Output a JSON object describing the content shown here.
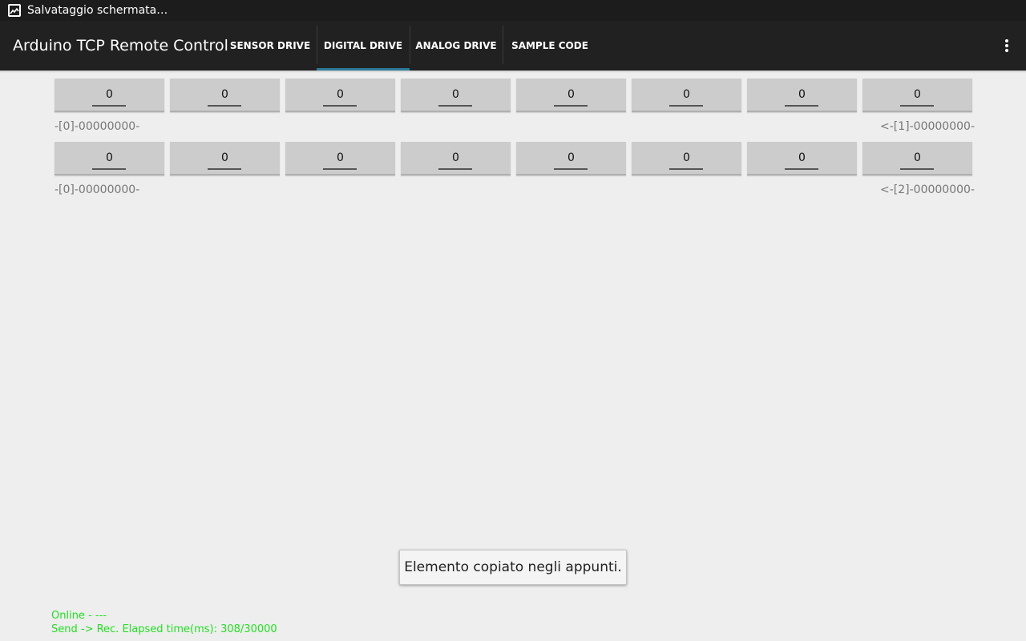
{
  "statusbar": {
    "notification_text": "Salvataggio schermata…",
    "icon": "image-icon"
  },
  "actionbar": {
    "title": "Arduino TCP Remote Control",
    "tabs": [
      {
        "label": "SENSOR DRIVE",
        "selected": false
      },
      {
        "label": "DIGITAL DRIVE",
        "selected": true
      },
      {
        "label": "ANALOG DRIVE",
        "selected": false
      },
      {
        "label": "SAMPLE CODE",
        "selected": false
      }
    ],
    "overflow_icon": "more-vert-icon",
    "accent_color": "#33b5e5"
  },
  "rows": [
    {
      "bits": [
        "0",
        "0",
        "0",
        "0",
        "0",
        "0",
        "0",
        "0"
      ],
      "left_label": "-[0]-00000000-",
      "right_label": "<-[1]-00000000-"
    },
    {
      "bits": [
        "0",
        "0",
        "0",
        "0",
        "0",
        "0",
        "0",
        "0"
      ],
      "left_label": "-[0]-00000000-",
      "right_label": "<-[2]-00000000-"
    }
  ],
  "toast": {
    "message": "Elemento copiato negli appunti."
  },
  "connection": {
    "status": "Online - ---",
    "elapsed": "Send -> Rec. Elapsed time(ms): 308/30000",
    "color": "#22e022"
  }
}
